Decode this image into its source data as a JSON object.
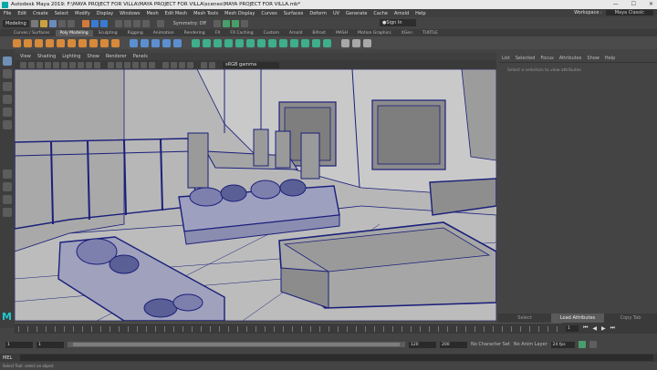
{
  "window": {
    "title": "Autodesk Maya 2019: F:\\MAYA PROJECT FOR VILLA\\MAYA PROJECT FOR VILLA\\scenes\\MAYA PROJECT FOR VILLA.mb*"
  },
  "menubar": {
    "items": [
      "File",
      "Edit",
      "Create",
      "Select",
      "Modify",
      "Display",
      "Windows",
      "Mesh",
      "Edit Mesh",
      "Mesh Tools",
      "Mesh Display",
      "Curves",
      "Surfaces",
      "Deform",
      "UV",
      "Generate",
      "Cache",
      "Arnold",
      "Help"
    ],
    "workspace_label": "Workspace :",
    "workspace_value": "Maya Classic"
  },
  "statusline": {
    "menuset": "Modeling",
    "symmetry": "Symmetry: Off",
    "sign_in": "Sign In"
  },
  "shelf_tabs": [
    "Curves / Surfaces",
    "Poly Modeling",
    "Sculpting",
    "Rigging",
    "Animation",
    "Rendering",
    "FX",
    "FX Caching",
    "Custom",
    "Arnold",
    "Bifrost",
    "MASH",
    "Motion Graphics",
    "XGen",
    "TURTLE"
  ],
  "active_shelf_tab": "Poly Modeling",
  "panel": {
    "menu": [
      "View",
      "Shading",
      "Lighting",
      "Show",
      "Renderer",
      "Panels"
    ],
    "colorspace": "sRGB gamma"
  },
  "right_panel": {
    "tabs": [
      "List",
      "Selected",
      "Focus",
      "Attributes",
      "Show",
      "Help"
    ],
    "message": "Select a selection to view attributes",
    "bottom_tabs": [
      "Select",
      "Load Attributes",
      "Copy Tab"
    ],
    "active_bottom": "Load Attributes"
  },
  "timeline": {
    "current_frame": "1",
    "playback_buttons": [
      "⏮",
      "◀",
      "▶",
      "⏭"
    ]
  },
  "range": {
    "start": "1",
    "inner_start": "1",
    "inner_end": "120",
    "end": "120",
    "anim_end": "200",
    "character_set": "No Character Set",
    "anim_layer": "No Anim Layer",
    "fps": "24 fps"
  },
  "command": {
    "label": "MEL"
  },
  "helpline": {
    "text": "Select Tool: select an object"
  },
  "colors": {
    "accent": "#6f8fb5",
    "maya_teal": "#1fc9cf",
    "viewport_bg": "#b9b9b9",
    "wire": "#1a1f7a"
  }
}
